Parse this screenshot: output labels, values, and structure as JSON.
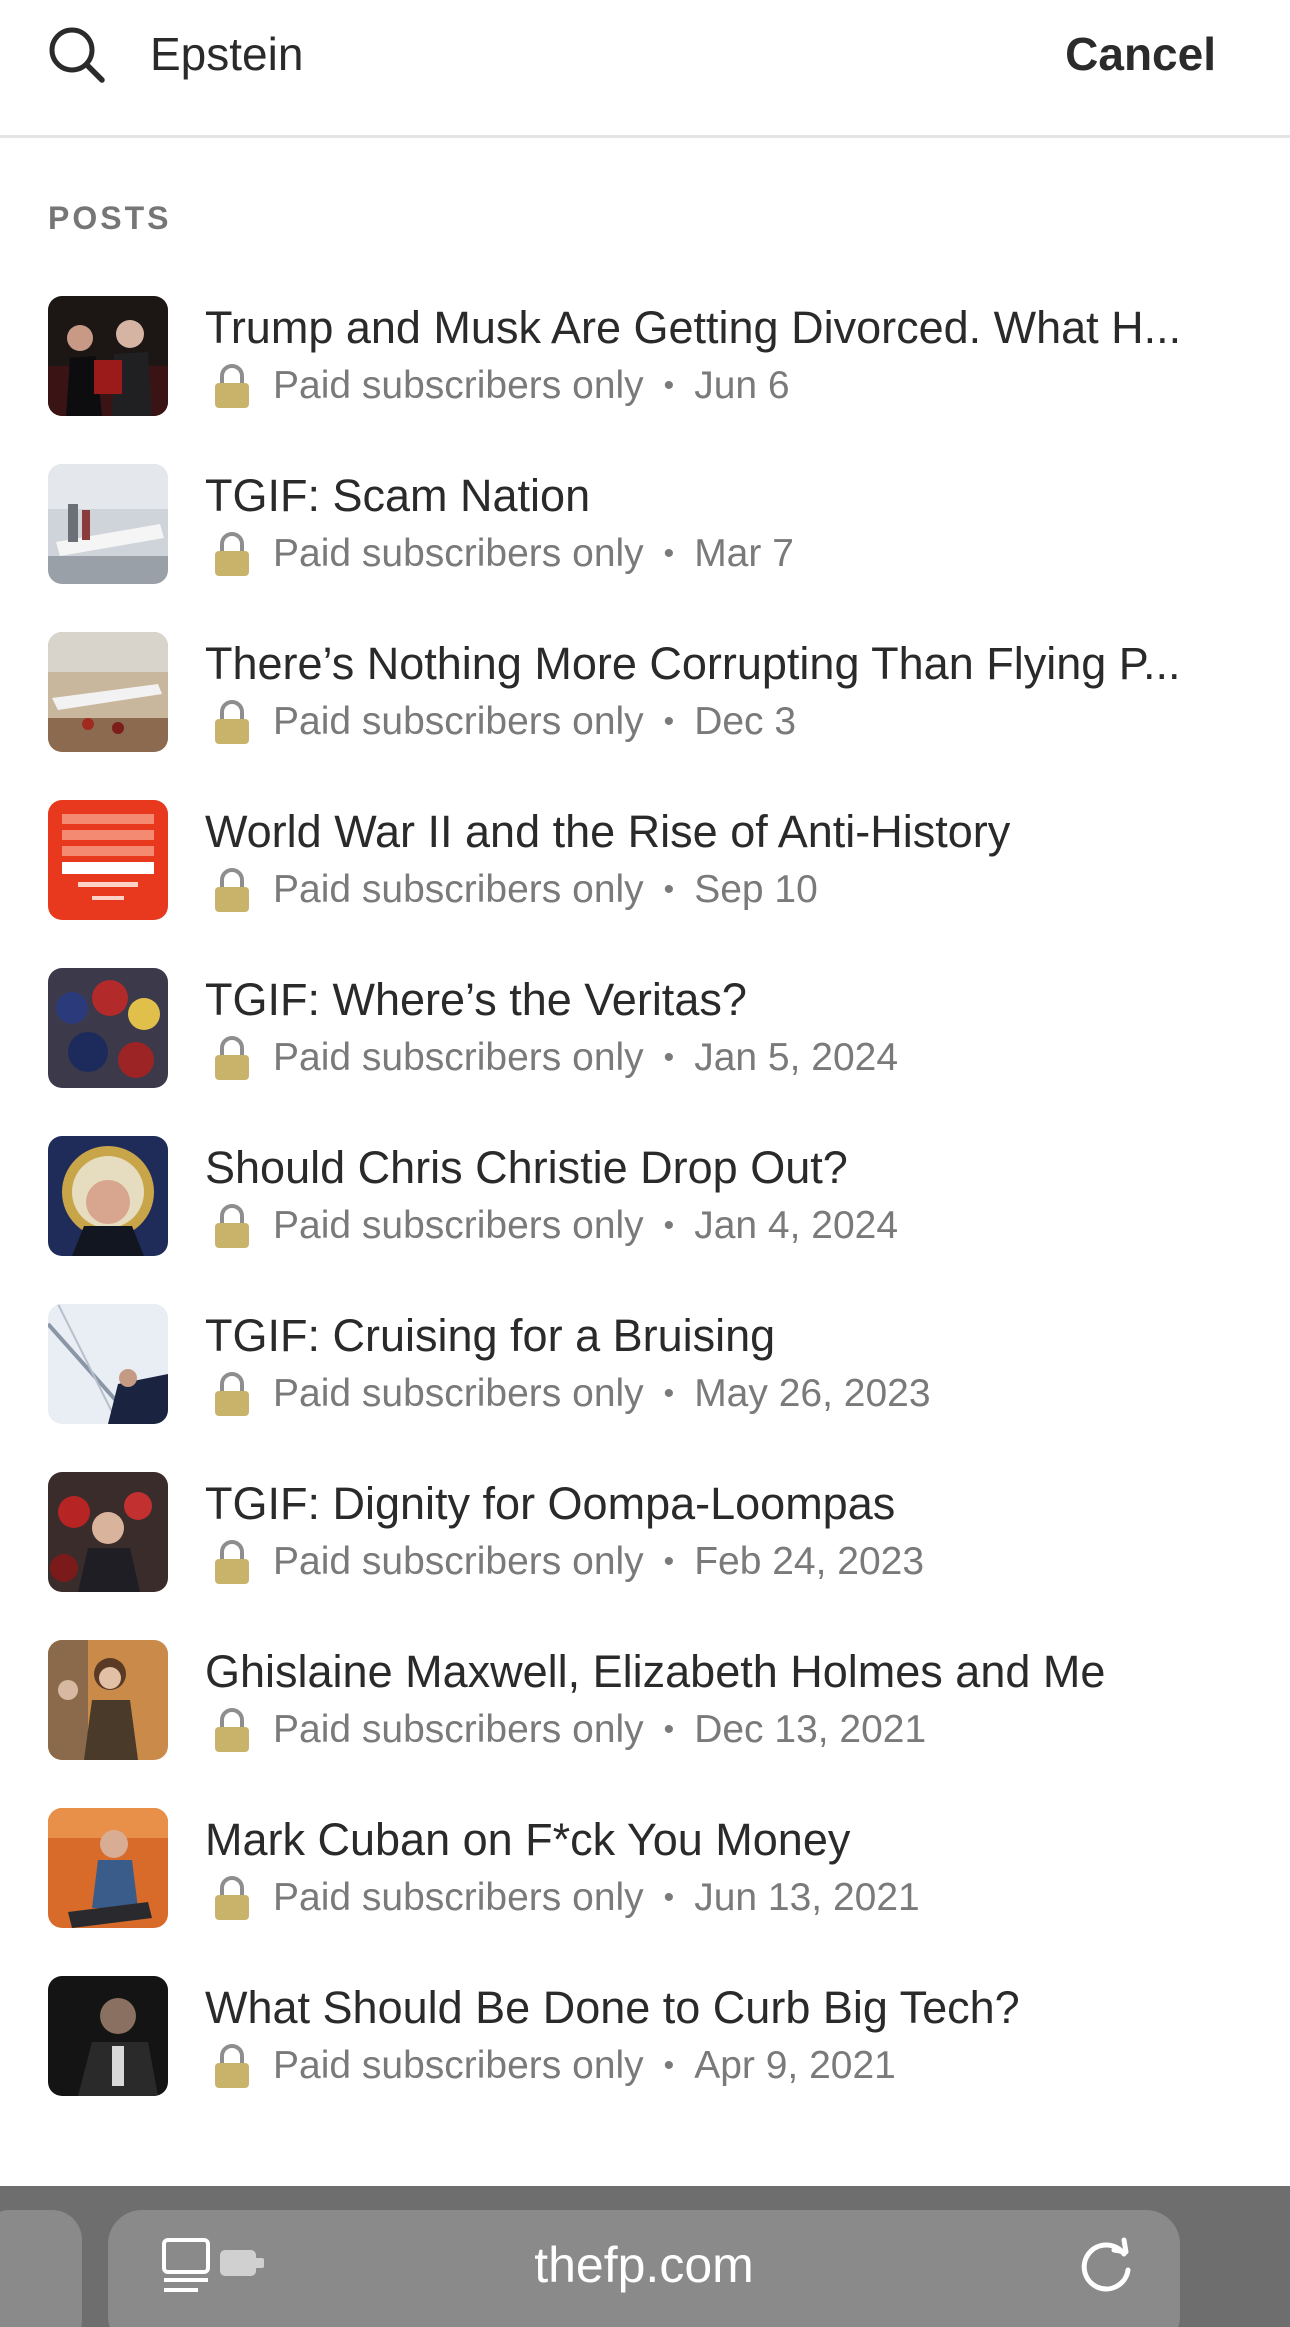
{
  "search": {
    "value": "Epstein",
    "cancel_label": "Cancel"
  },
  "section": {
    "label": "POSTS"
  },
  "results": [
    {
      "title": "Trump and Musk Are Getting Divorced. What H...",
      "access": "Paid subscribers only",
      "date": "Jun 6"
    },
    {
      "title": "TGIF: Scam Nation",
      "access": "Paid subscribers only",
      "date": "Mar 7"
    },
    {
      "title": "There’s Nothing More Corrupting Than Flying P...",
      "access": "Paid subscribers only",
      "date": "Dec 3"
    },
    {
      "title": "World War II and the Rise of Anti-History",
      "access": "Paid subscribers only",
      "date": "Sep 10"
    },
    {
      "title": "TGIF: Where’s the Veritas?",
      "access": "Paid subscribers only",
      "date": "Jan 5, 2024"
    },
    {
      "title": "Should Chris Christie Drop Out?",
      "access": "Paid subscribers only",
      "date": "Jan 4, 2024"
    },
    {
      "title": "TGIF: Cruising for a Bruising",
      "access": "Paid subscribers only",
      "date": "May 26, 2023"
    },
    {
      "title": "TGIF: Dignity for Oompa-Loompas",
      "access": "Paid subscribers only",
      "date": "Feb 24, 2023"
    },
    {
      "title": "Ghislaine Maxwell, Elizabeth Holmes and Me",
      "access": "Paid subscribers only",
      "date": "Dec 13, 2021"
    },
    {
      "title": "Mark Cuban on F*ck You Money",
      "access": "Paid subscribers only",
      "date": "Jun 13, 2021"
    },
    {
      "title": "What Should Be Done to Curb Big Tech?",
      "access": "Paid subscribers only",
      "date": "Apr 9, 2021"
    }
  ],
  "browser": {
    "url": "thefp.com"
  },
  "colors": {
    "text": "#2a2a2a",
    "muted": "#7a7a7a",
    "toolbar": "#6e6e6e",
    "lock": "#c9b26a"
  }
}
